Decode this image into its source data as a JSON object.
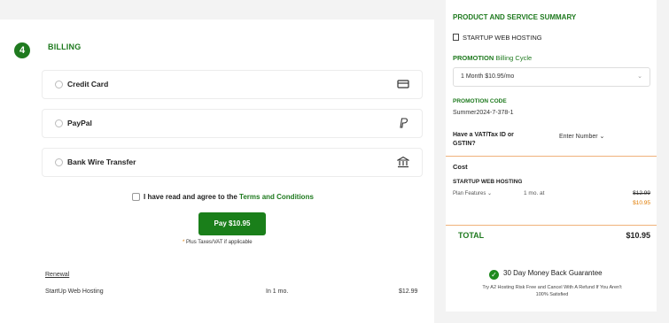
{
  "billing": {
    "step": "4",
    "title": "BILLING",
    "options": [
      {
        "label": "Credit Card",
        "icon": "credit-card-icon"
      },
      {
        "label": "PayPal",
        "icon": "paypal-icon"
      },
      {
        "label": "Bank Wire Transfer",
        "icon": "bank-icon"
      }
    ],
    "agree_prefix": "I have read and agree to the",
    "agree_link": "Terms and Conditions",
    "pay_button": "Pay $10.95",
    "tax_note_star": "*",
    "tax_note": "Plus Taxes/VAT if applicable",
    "renewal": {
      "label": "Renewal",
      "product": "StartUp Web Hosting",
      "period": "In 1 mo.",
      "price": "$12.99"
    }
  },
  "summary": {
    "title": "PRODUCT AND SERVICE SUMMARY",
    "product": "STARTUP WEB HOSTING",
    "promo_prefix": "PROMOTION",
    "promo_label": "Billing Cycle",
    "cycle_selected": "1 Month $10.95/mo",
    "promo_code_label": "PROMOTION CODE",
    "promo_code": "Summer2024-7-378-1",
    "vat_label": "Have a VAT/Tax ID or GSTIN?",
    "vat_input": "Enter Number",
    "cost_label": "Cost",
    "cost_item": "STARTUP WEB HOSTING",
    "plan_features": "Plan Features",
    "period": "1 mo. at",
    "old_price": "$12.99",
    "new_price": "$10.95",
    "total_label": "TOTAL",
    "total_value": "$10.95",
    "guarantee": "30 Day Money Back Guarantee",
    "guarantee_sub": "Try A2 Hosting Risk Free and Cancel With A Refund If You Aren't 100% Satisfied",
    "accent": "#1f7a1f",
    "orange": "#e07b00"
  }
}
